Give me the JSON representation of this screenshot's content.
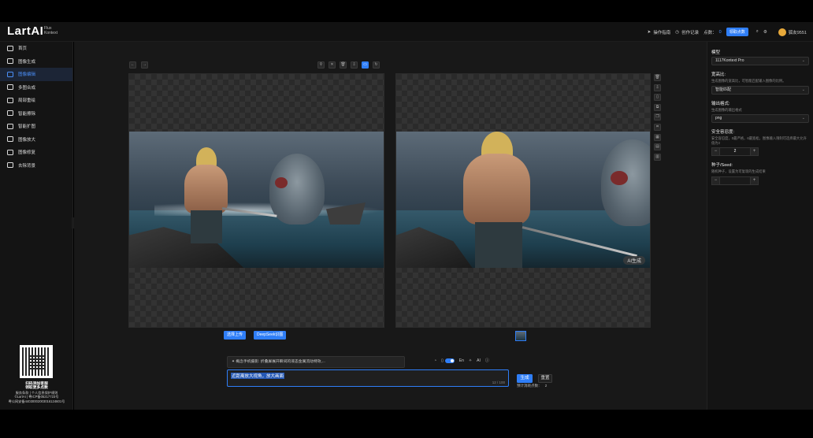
{
  "app": {
    "logo": "LartAI",
    "logo_sub_1": "Flux",
    "logo_sub_2": "Kontext"
  },
  "topbar": {
    "guide": "操作指南",
    "history": "创作记录",
    "points_label": "点数：",
    "points_value": "0",
    "claim_button": "领取点数",
    "username": "狐友9551"
  },
  "sidebar": {
    "items": [
      {
        "label": "首页",
        "icon": "home-icon"
      },
      {
        "label": "图像生成",
        "icon": "image-gen-icon"
      },
      {
        "label": "图像编辑",
        "icon": "image-edit-icon",
        "active": true
      },
      {
        "label": "多图合成",
        "icon": "multi-image-icon"
      },
      {
        "label": "局部重绘",
        "icon": "inpaint-icon"
      },
      {
        "label": "智能擦除",
        "icon": "eraser-icon"
      },
      {
        "label": "智能扩图",
        "icon": "outpaint-icon"
      },
      {
        "label": "图像放大",
        "icon": "upscale-icon"
      },
      {
        "label": "图像修复",
        "icon": "repair-icon"
      },
      {
        "label": "去除背景",
        "icon": "remove-bg-icon"
      }
    ],
    "footer": {
      "line1": "扫码添加客服",
      "line2": "领取更多点数",
      "line3": "服务条款 | 个人信息保护规则",
      "line4": "©LartAI | 粤ICP备05217723号",
      "line5": "粤公网安备44030002003016124601号"
    }
  },
  "editor": {
    "toolbar_icons": [
      "undo-icon",
      "redo-icon"
    ],
    "canvas_tools": [
      "pin-icon",
      "close-icon",
      "delete-icon",
      "download-icon",
      "fit-icon",
      "refresh-icon"
    ],
    "right_tools": [
      "delete-icon",
      "download-icon",
      "bookmark-icon",
      "compare-icon",
      "copy-icon",
      "crop-icon",
      "grid-icon",
      "file-icon",
      "file-alt-icon"
    ],
    "result_badge": "AI生成",
    "upload_button": "选择上传",
    "deepseek_button": "DeepSeek识图"
  },
  "prompt": {
    "tip": "概念手机摄影: 折叠屏展开瞬间的液态金属流动特效,...",
    "opt_en": "En",
    "opt_ai": "AI",
    "text": "近距离放大视角，放大画面",
    "counter": "12 / 100",
    "generate_button": "生成",
    "reset_button": "重置",
    "cost_label": "预计消耗点数：",
    "cost_value": "2"
  },
  "panel": {
    "model_label": "模型",
    "model_value": "1117Kontext Pro",
    "ratio_label": "宽高比:",
    "ratio_desc": "生成图像的宽高比，可智能匹配输入图像的比例。",
    "ratio_value": "智能匹配",
    "format_label": "输出格式:",
    "format_desc": "生成图像的输出格式",
    "format_value": "png",
    "safety_label": "安全容忍度:",
    "safety_desc": "安全容忍度，0最严格，6最宽松，图像输入限制可选择最大允许值为2",
    "safety_value": "2",
    "seed_label": "种子/Seed:",
    "seed_desc": "随机种子，设置为可复现的生成结果",
    "seed_value": ""
  }
}
